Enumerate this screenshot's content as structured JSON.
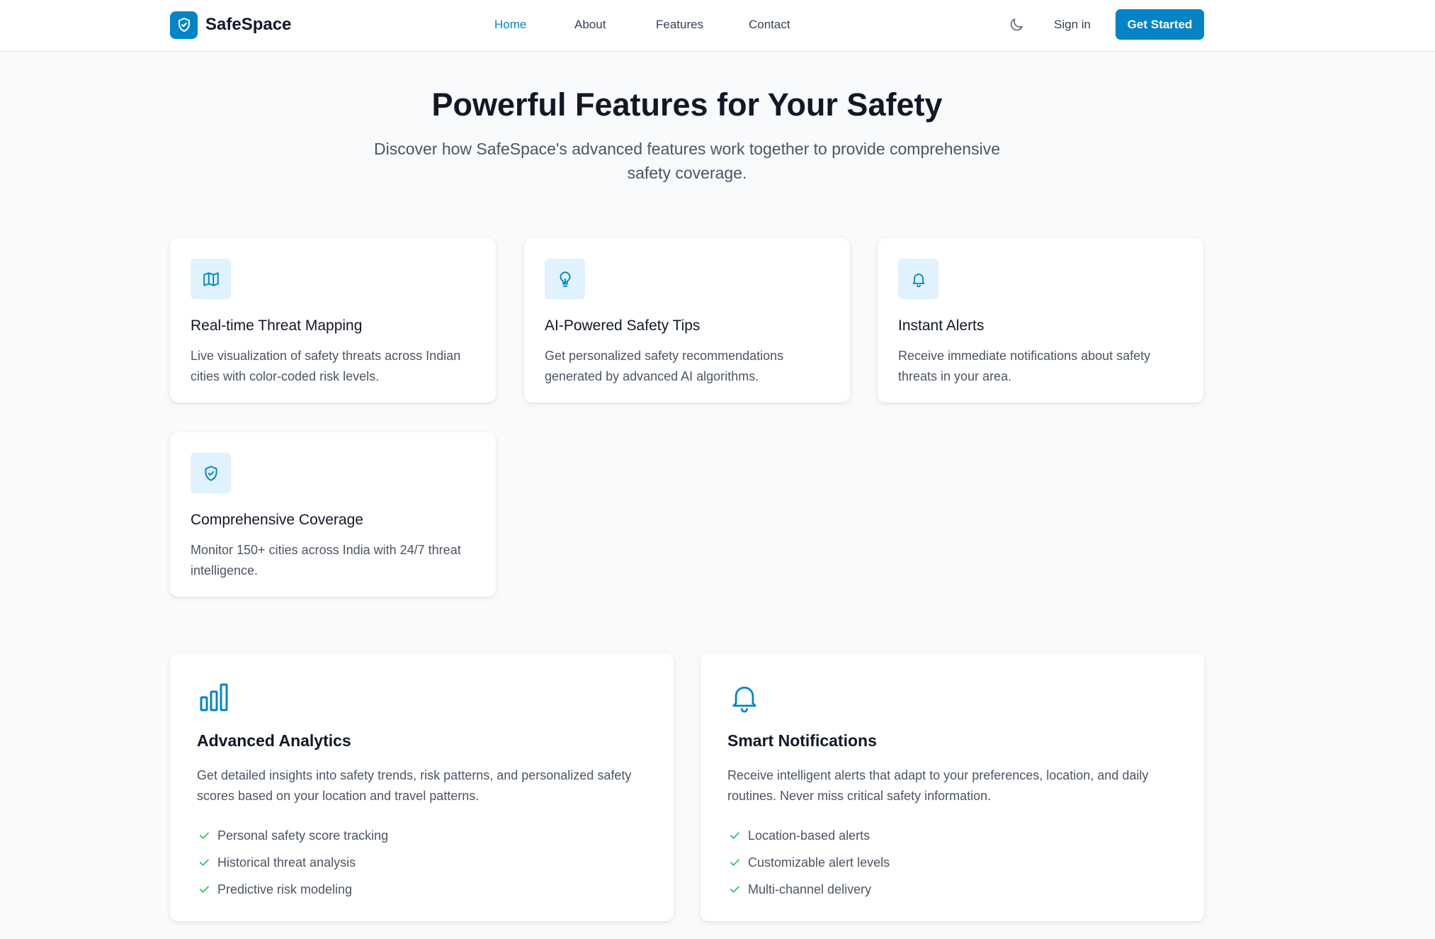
{
  "header": {
    "brand": "SafeSpace",
    "nav": [
      {
        "label": "Home",
        "active": true
      },
      {
        "label": "About",
        "active": false
      },
      {
        "label": "Features",
        "active": false
      },
      {
        "label": "Contact",
        "active": false
      }
    ],
    "theme_icon": "moon-icon",
    "signin_label": "Sign in",
    "cta_label": "Get Started"
  },
  "hero": {
    "title": "Powerful Features for Your Safety",
    "subtitle": "Discover how SafeSpace's advanced features work together to provide comprehensive safety coverage."
  },
  "features": [
    {
      "icon": "map-icon",
      "title": "Real-time Threat Mapping",
      "description": "Live visualization of safety threats across Indian cities with color-coded risk levels."
    },
    {
      "icon": "lightbulb-icon",
      "title": "AI-Powered Safety Tips",
      "description": "Get personalized safety recommendations generated by advanced AI algorithms."
    },
    {
      "icon": "bell-icon",
      "title": "Instant Alerts",
      "description": "Receive immediate notifications about safety threats in your area."
    },
    {
      "icon": "shield-check-icon",
      "title": "Comprehensive Coverage",
      "description": "Monitor 150+ cities across India with 24/7 threat intelligence."
    }
  ],
  "highlights": [
    {
      "icon": "bar-chart-icon",
      "title": "Advanced Analytics",
      "description": "Get detailed insights into safety trends, risk patterns, and personalized safety scores based on your location and travel patterns.",
      "items": [
        "Personal safety score tracking",
        "Historical threat analysis",
        "Predictive risk modeling"
      ]
    },
    {
      "icon": "bell-icon",
      "title": "Smart Notifications",
      "description": "Receive intelligent alerts that adapt to your preferences, location, and daily routines. Never miss critical safety information.",
      "items": [
        "Location-based alerts",
        "Customizable alert levels",
        "Multi-channel delivery"
      ]
    }
  ],
  "colors": {
    "accent": "#0284c7",
    "accent_light": "#e0f2fe",
    "check": "#22c55e",
    "background": "#f8fafc"
  }
}
